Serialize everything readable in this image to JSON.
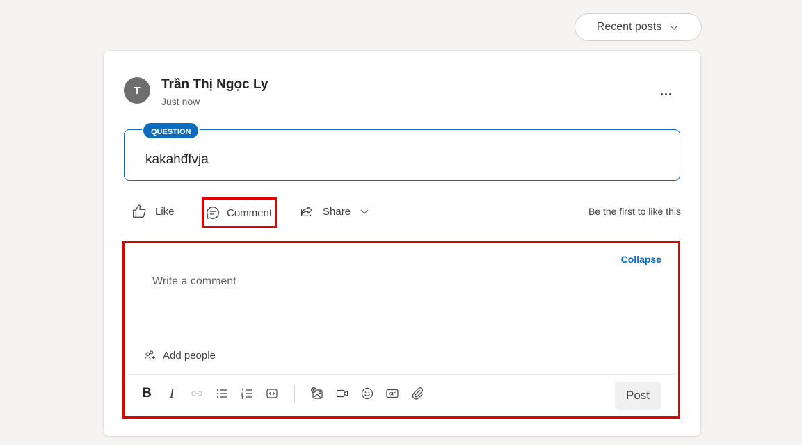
{
  "header": {
    "recent_posts_label": "Recent posts"
  },
  "post": {
    "author_initial": "T",
    "author_name": "Trần Thị Ngọc Ly",
    "time": "Just now",
    "more_label": "...",
    "badge": "QUESTION",
    "question_text": "kakahđfvja"
  },
  "actions": {
    "like_label": "Like",
    "comment_label": "Comment",
    "share_label": "Share",
    "first_like_text": "Be the first to like this"
  },
  "comment_panel": {
    "collapse_label": "Collapse",
    "placeholder": "Write a comment",
    "add_people_label": "Add people",
    "bold_label": "B",
    "italic_label": "I",
    "post_label": "Post"
  },
  "colors": {
    "accent": "#0f6cbd",
    "highlight": "#e00000",
    "avatar": "#6e6e6e"
  }
}
